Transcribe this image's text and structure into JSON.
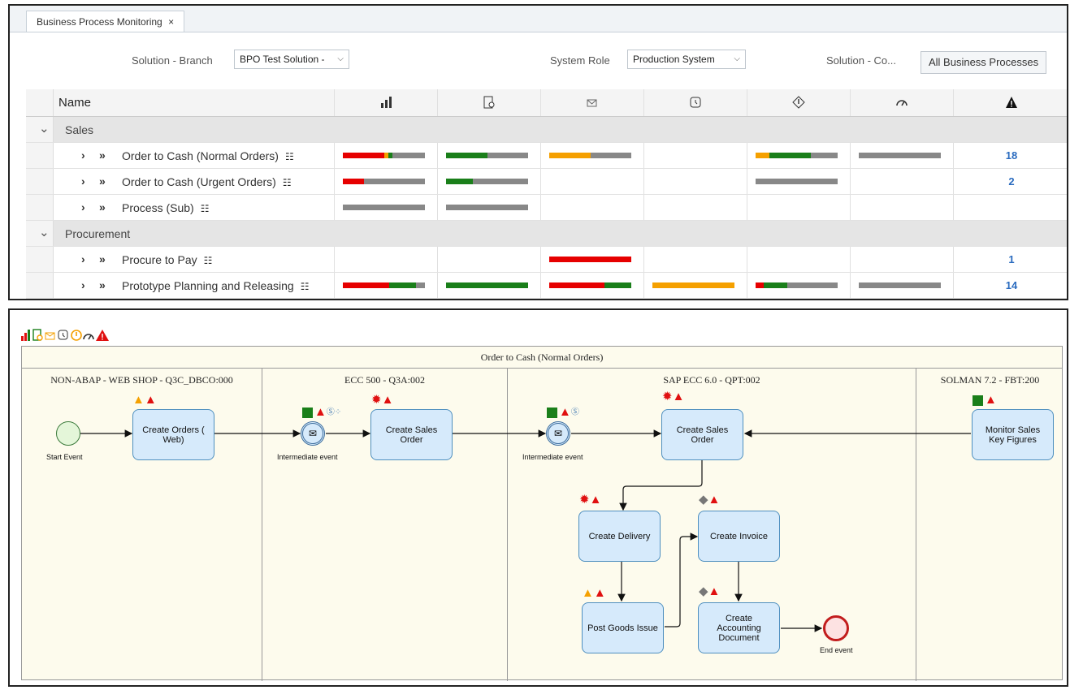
{
  "tab": {
    "label": "Business Process Monitoring",
    "close": "×"
  },
  "filters": {
    "solution_branch_label": "Solution - Branch",
    "solution_branch_value": "BPO Test Solution -",
    "system_role_label": "System Role",
    "system_role_value": "Production System",
    "solution_co_label": "Solution - Co...",
    "all_bp_button": "All Business Processes"
  },
  "grid": {
    "name_header": "Name",
    "column_icons": [
      "chart-bars-icon",
      "document-search-icon",
      "envelope-error-icon",
      "clock-icon",
      "diamond-exclamation-icon",
      "speedometer-icon",
      "warning-triangle-icon"
    ],
    "groups": [
      {
        "label": "Sales"
      },
      {
        "label": "Procurement"
      }
    ],
    "rows": [
      {
        "label": "Order to Cash (Normal Orders)",
        "alerts": "18"
      },
      {
        "label": "Order to Cash (Urgent Orders)",
        "alerts": "2"
      },
      {
        "label": "Process (Sub)",
        "alerts": ""
      },
      {
        "label": "Procure to Pay",
        "alerts": "1"
      },
      {
        "label": "Prototype Planning and Releasing",
        "alerts": "14"
      }
    ],
    "bars": {
      "r0": [
        [
          {
            "c": "#e60000",
            "w": 0.5
          },
          {
            "c": "#f5a000",
            "w": 0.05
          },
          {
            "c": "#1a7f1a",
            "w": 0.05
          },
          {
            "c": "#888",
            "w": 0.4
          }
        ],
        [
          {
            "c": "#1a7f1a",
            "w": 0.5
          },
          {
            "c": "#888",
            "w": 0.5
          }
        ],
        [
          {
            "c": "#f5a000",
            "w": 0.5
          },
          {
            "c": "#888",
            "w": 0.5
          }
        ],
        null,
        [
          {
            "c": "#f5a000",
            "w": 0.17
          },
          {
            "c": "#1a7f1a",
            "w": 0.5
          },
          {
            "c": "#888",
            "w": 0.33
          }
        ],
        [
          {
            "c": "#888",
            "w": 1
          }
        ]
      ],
      "r1": [
        [
          {
            "c": "#e60000",
            "w": 0.26
          },
          {
            "c": "#888",
            "w": 0.74
          }
        ],
        [
          {
            "c": "#1a7f1a",
            "w": 0.33
          },
          {
            "c": "#888",
            "w": 0.67
          }
        ],
        null,
        null,
        [
          {
            "c": "#888",
            "w": 1
          }
        ],
        null
      ],
      "r2": [
        [
          {
            "c": "#888",
            "w": 1
          }
        ],
        [
          {
            "c": "#888",
            "w": 1
          }
        ],
        null,
        null,
        null,
        null
      ],
      "r3": [
        null,
        null,
        [
          {
            "c": "#e60000",
            "w": 1
          }
        ],
        null,
        null,
        null
      ],
      "r4": [
        [
          {
            "c": "#e60000",
            "w": 0.56
          },
          {
            "c": "#1a7f1a",
            "w": 0.33
          },
          {
            "c": "#888",
            "w": 0.11
          }
        ],
        [
          {
            "c": "#1a7f1a",
            "w": 1
          }
        ],
        [
          {
            "c": "#e60000",
            "w": 0.67
          },
          {
            "c": "#1a7f1a",
            "w": 0.33
          }
        ],
        [
          {
            "c": "#f5a000",
            "w": 1
          }
        ],
        [
          {
            "c": "#e60000",
            "w": 0.1
          },
          {
            "c": "#1a7f1a",
            "w": 0.29
          },
          {
            "c": "#888",
            "w": 0.61
          }
        ],
        [
          {
            "c": "#888",
            "w": 1
          }
        ]
      ]
    }
  },
  "diagram": {
    "pool_title": "Order to Cash (Normal Orders)",
    "lanes": [
      {
        "title": "NON-ABAP - WEB SHOP - Q3C_DBCO:000"
      },
      {
        "title": "ECC 500 - Q3A:002"
      },
      {
        "title": "SAP ECC 6.0 - QPT:002"
      },
      {
        "title": "SOLMAN 7.2 - FBT:200"
      }
    ],
    "start_event": "Start Event",
    "end_event": "End event",
    "intermediate_event": "Intermediate event",
    "tasks": {
      "create_orders_web": "Create Orders ( Web)",
      "create_sales_order_1": "Create Sales Order",
      "create_sales_order_2": "Create Sales Order",
      "monitor_sales": "Monitor Sales Key Figures",
      "create_delivery": "Create Delivery",
      "create_invoice": "Create Invoice",
      "post_goods_issue": "Post Goods Issue",
      "create_accounting": "Create Accounting Document"
    }
  }
}
